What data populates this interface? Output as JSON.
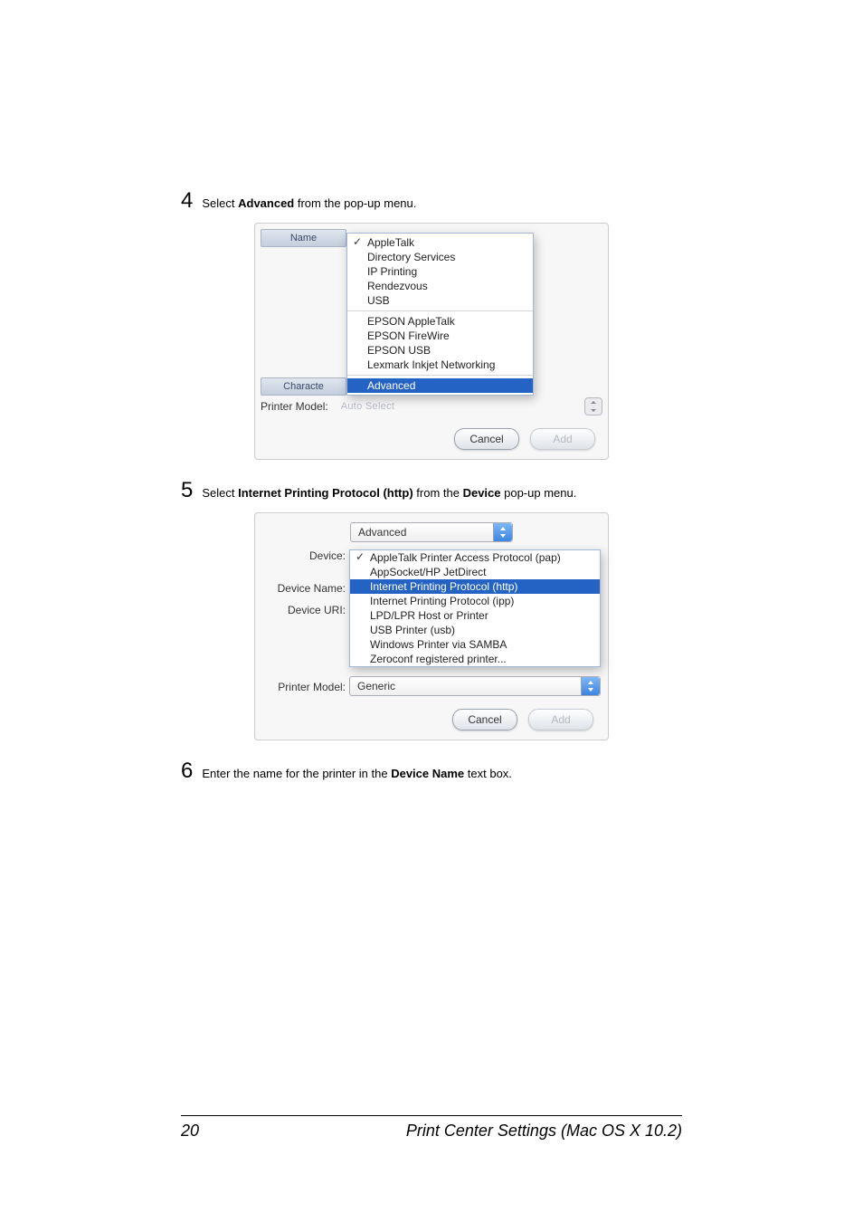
{
  "steps": {
    "s4": {
      "num": "4",
      "pre": "Select ",
      "bold": "Advanced",
      "post": " from the pop-up menu."
    },
    "s5": {
      "num": "5",
      "pre": "Select ",
      "bold": "Internet Printing Protocol (http)",
      "mid": " from the ",
      "bold2": "Device",
      "post": " pop-up menu."
    },
    "s6": {
      "num": "6",
      "pre": "Enter the name for the printer in the ",
      "bold": "Device Name",
      "post": " text box."
    }
  },
  "dlg1": {
    "name_header": "Name",
    "char_header": "Characte",
    "menu": {
      "apple_talk": "AppleTalk",
      "dir_services": "Directory Services",
      "ip_printing": "IP Printing",
      "rendezvous": "Rendezvous",
      "usb": "USB",
      "epson_at": "EPSON AppleTalk",
      "epson_fw": "EPSON FireWire",
      "epson_usb": "EPSON USB",
      "lexmark": "Lexmark Inkjet Networking",
      "advanced": "Advanced"
    },
    "printer_model_label": "Printer Model:",
    "auto_select": "Auto Select",
    "cancel": "Cancel",
    "add": "Add"
  },
  "dlg2": {
    "top_popup": "Advanced",
    "labels": {
      "device": "Device:",
      "device_name": "Device Name:",
      "device_uri": "Device URI:",
      "printer_model": "Printer Model:"
    },
    "menu": {
      "pap": "AppleTalk Printer Access Protocol (pap)",
      "appsocket": "AppSocket/HP JetDirect",
      "ipp_http": "Internet Printing Protocol (http)",
      "ipp_ipp": "Internet Printing Protocol (ipp)",
      "lpd": "LPD/LPR Host or Printer",
      "usb": "USB Printer (usb)",
      "samba": "Windows Printer via SAMBA",
      "zeroconf": "Zeroconf registered printer..."
    },
    "generic": "Generic",
    "cancel": "Cancel",
    "add": "Add"
  },
  "footer": {
    "page": "20",
    "title": "Print Center Settings (Mac OS X 10.2)"
  }
}
